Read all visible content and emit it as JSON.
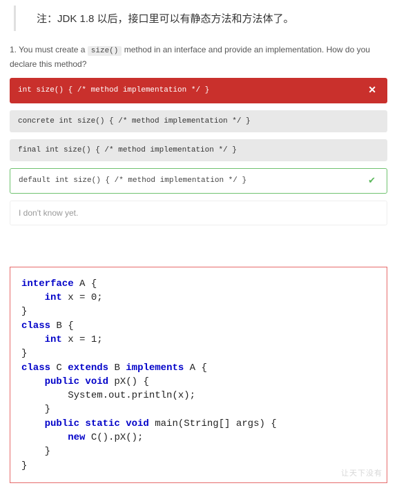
{
  "note": "注：JDK 1.8 以后，接口里可以有静态方法和方法体了。",
  "question": {
    "number": "1.",
    "prefix": "You must create a ",
    "code": "size()",
    "suffix": " method in an interface and provide an implementation. How do you declare this method?"
  },
  "answers": [
    {
      "text": "int size() { /* method implementation */ }",
      "style": "red",
      "marker": "close"
    },
    {
      "text": "concrete int size() { /* method implementation */ }",
      "style": "grey",
      "marker": ""
    },
    {
      "text": "final int size() { /* method implementation */ }",
      "style": "grey",
      "marker": ""
    },
    {
      "text": "default int size() { /* method implementation */ }",
      "style": "green",
      "marker": "check"
    },
    {
      "text": "I don't know yet.",
      "style": "plain",
      "marker": ""
    }
  ],
  "code": {
    "l1a": "interface",
    "l1b": " A {",
    "l2a": "    ",
    "l2b": "int",
    "l2c": " x = 0;",
    "l3": "}",
    "l4a": "class",
    "l4b": " B {",
    "l5a": "    ",
    "l5b": "int",
    "l5c": " x = 1;",
    "l6": "}",
    "l7a": "class",
    "l7b": " C ",
    "l7c": "extends",
    "l7d": " B ",
    "l7e": "implements",
    "l7f": " A {",
    "l8a": "    ",
    "l8b": "public void",
    "l8c": " pX() {",
    "l9": "        System.out.println(x);",
    "l10": "    }",
    "l11a": "    ",
    "l11b": "public static void",
    "l11c": " main(String[] args) {",
    "l12a": "        ",
    "l12b": "new",
    "l12c": " C().pX();",
    "l13": "    }",
    "l14": "}"
  },
  "watermark": "让天下没有"
}
